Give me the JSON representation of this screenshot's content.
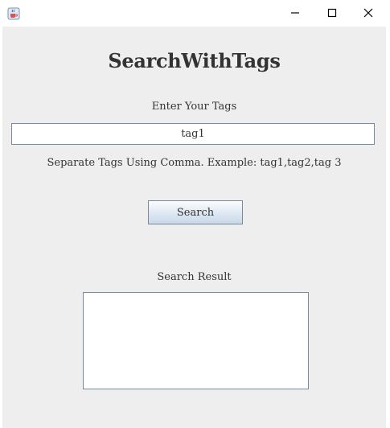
{
  "window": {
    "title": "",
    "icon": "java-coffee-cup-icon",
    "controls": {
      "minimize_icon": "minimize-icon",
      "maximize_icon": "maximize-icon",
      "close_icon": "close-icon"
    }
  },
  "app": {
    "title": "SearchWithTags",
    "tags_label": "Enter Your Tags",
    "tags_value": "tag1",
    "hint": "Separate Tags Using Comma. Example: tag1,tag2,tag 3",
    "search_label": "Search",
    "result_label": "Search Result",
    "result_value": ""
  },
  "colors": {
    "content_bg": "#eeeeee",
    "titlebar_bg": "#ffffff",
    "field_border": "#7a8a99",
    "text": "#333333"
  }
}
